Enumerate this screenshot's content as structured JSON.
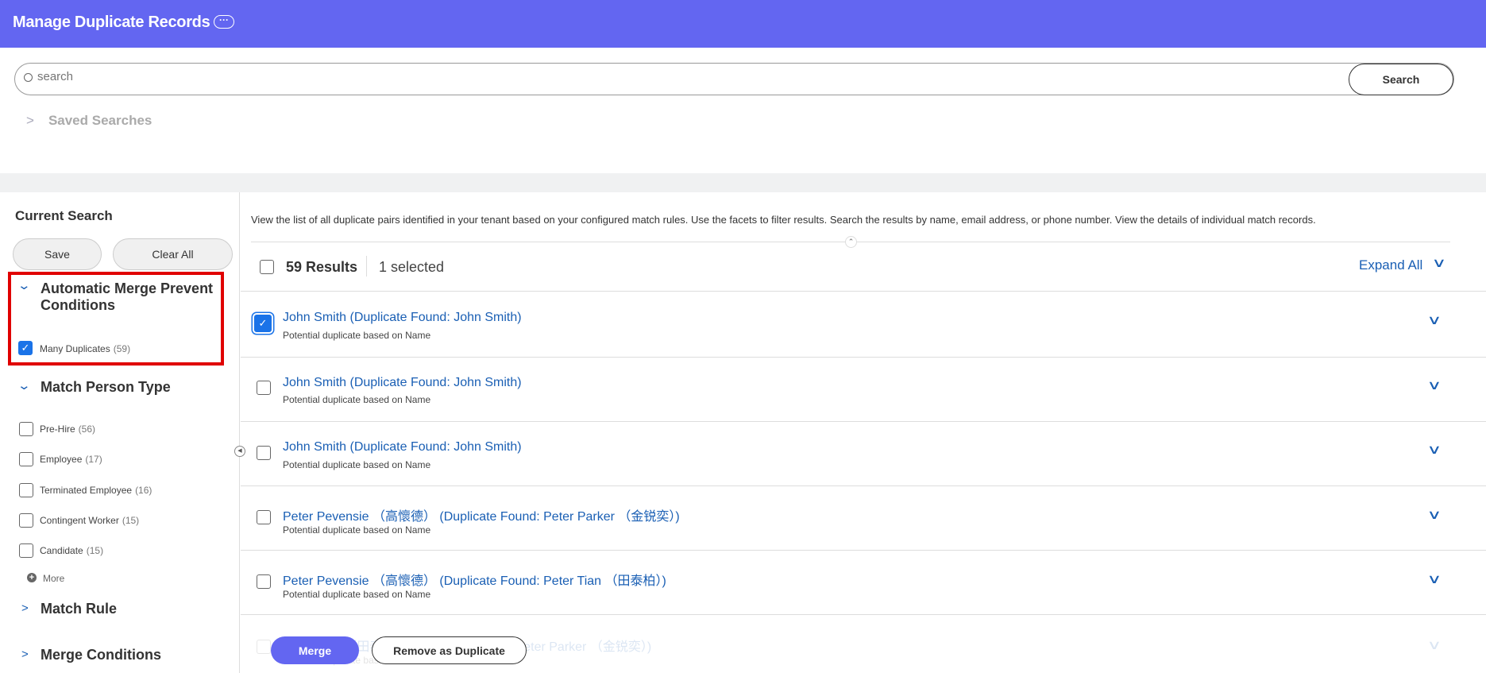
{
  "header": {
    "title": "Manage Duplicate Records",
    "more_icon": "ellipsis-icon",
    "color": "#6366f1"
  },
  "search": {
    "placeholder": "search",
    "button": "Search"
  },
  "saved_searches": "Saved Searches",
  "sidebar": {
    "current_search": "Current Search",
    "save": "Save",
    "clear_all": "Clear All",
    "facets": [
      {
        "title": "Automatic Merge Prevent Conditions",
        "expanded": true,
        "items": [
          {
            "label": "Many Duplicates",
            "count": "(59)",
            "checked": true
          }
        ]
      },
      {
        "title": "Match Person Type",
        "expanded": true,
        "items": [
          {
            "label": "Pre-Hire",
            "count": "(56)",
            "checked": false
          },
          {
            "label": "Employee",
            "count": "(17)",
            "checked": false
          },
          {
            "label": "Terminated Employee",
            "count": "(16)",
            "checked": false
          },
          {
            "label": "Contingent Worker",
            "count": "(15)",
            "checked": false
          },
          {
            "label": "Candidate",
            "count": "(15)",
            "checked": false
          }
        ],
        "more": "More"
      },
      {
        "title": "Match Rule",
        "expanded": false
      },
      {
        "title": "Merge Conditions",
        "expanded": false
      }
    ]
  },
  "main": {
    "description": "View the list of all duplicate pairs identified in your tenant based on your configured match rules. Use the facets to filter results. Search the results by name, email address, or phone number. View the details of individual match records.",
    "results": "59 Results",
    "selected": "1 selected",
    "expand_all": "Expand All",
    "rows": [
      {
        "title": "John Smith (Duplicate Found: John Smith)",
        "subtitle": "Potential duplicate based on Name",
        "checked": true
      },
      {
        "title": "John Smith (Duplicate Found: John Smith)",
        "subtitle": "Potential duplicate based on Name",
        "checked": false
      },
      {
        "title": "John Smith (Duplicate Found: John Smith)",
        "subtitle": "Potential duplicate based on Name",
        "checked": false
      },
      {
        "title": "Peter Pevensie （高懷德） (Duplicate Found: Peter Parker （金锐奕）)",
        "subtitle": "Potential duplicate based on Name",
        "checked": false
      },
      {
        "title": "Peter Pevensie （高懷德） (Duplicate Found: Peter Tian （田泰柏）)",
        "subtitle": "Potential duplicate based on Name",
        "checked": false
      },
      {
        "title": "Peter Tian （田泰柏） (Duplicate Found: Peter Parker （金锐奕）)",
        "subtitle": "Potential duplicate based on Name",
        "checked": false
      }
    ],
    "merge": "Merge",
    "remove": "Remove as Duplicate"
  }
}
